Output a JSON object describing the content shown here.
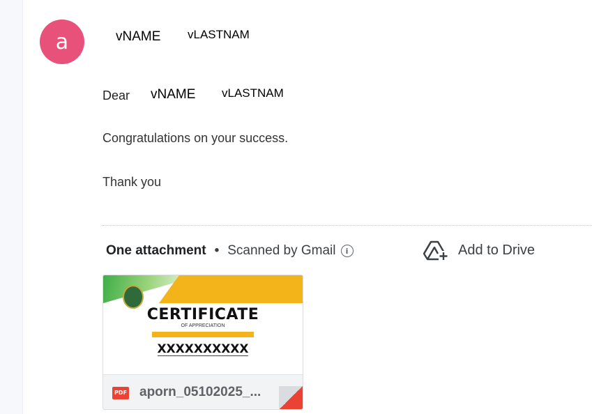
{
  "sender": {
    "avatar_letter": "a",
    "first_name": "vNAME",
    "last_name": "vLASTNAM"
  },
  "message": {
    "greeting": "Dear",
    "first_name": "vNAME",
    "last_name": "vLASTNAM",
    "congrats": "Congratulations on your success.",
    "thanks": "Thank you"
  },
  "attachments": {
    "count_label": "One attachment",
    "separator": "•",
    "scanned_label": "Scanned by Gmail",
    "info_glyph": "i",
    "add_to_drive_label": "Add to Drive",
    "file": {
      "type_badge": "PDF",
      "name": "aporn_05102025_..."
    },
    "thumbnail": {
      "title": "CERTIFICATE",
      "subtitle": "OF APPRECIATION",
      "recipient": "XXXXXXXXXX"
    }
  },
  "colors": {
    "avatar_bg": "#e8517a",
    "pdf_red": "#ea4335",
    "cert_gold": "#f3b41a",
    "cert_green": "#3fae49"
  },
  "icons": {
    "info": "info-icon",
    "drive": "add-to-drive-icon",
    "pdf": "pdf-icon"
  }
}
